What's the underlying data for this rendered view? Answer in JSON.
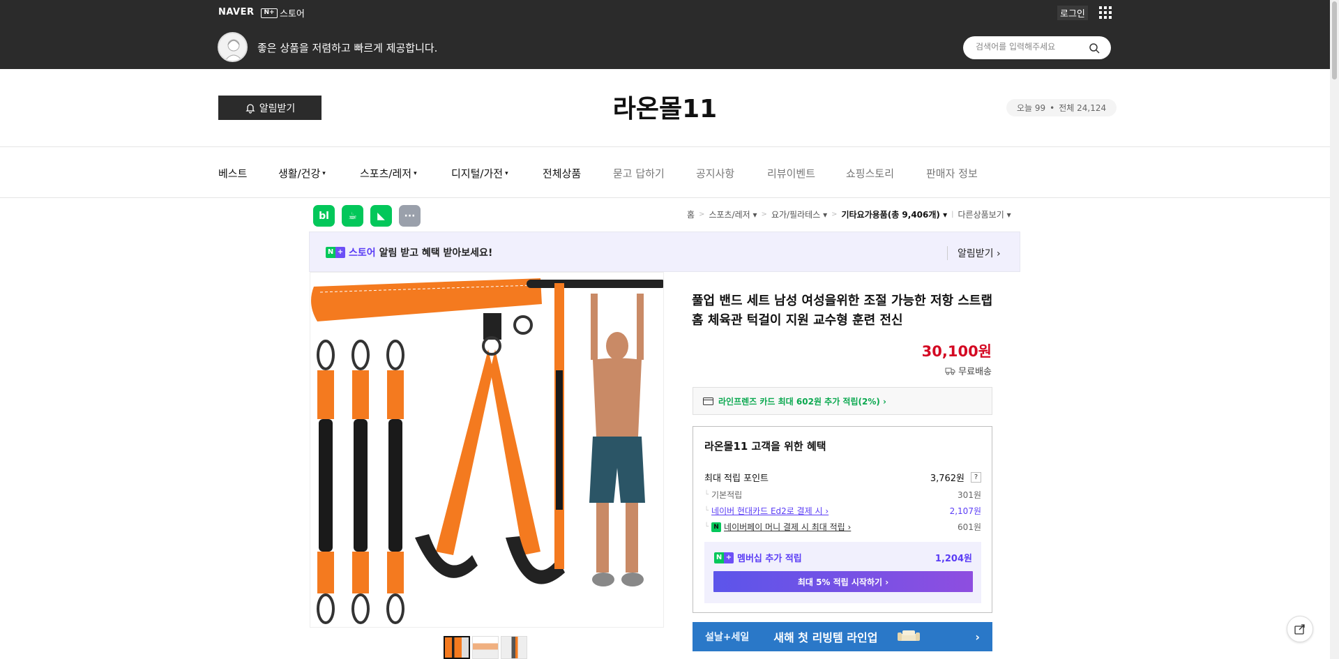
{
  "topbar": {
    "naver_logo": "NAVER",
    "nstore_box": "N+",
    "nstore_label": "스토어",
    "login": "로그인",
    "slogan": "좋은 상품을 저렴하고 빠르게 제공합니다.",
    "search_placeholder": "검색어를 입력해주세요"
  },
  "store": {
    "notify_button": "알림받기",
    "title": "라온몰11",
    "visits_today": "오늘 99",
    "visits_dot": "•",
    "visits_total": "전체 24,124"
  },
  "nav": {
    "items": [
      "베스트",
      "생활/건강",
      "스포츠/레저",
      "디지털/가전",
      "전체상품",
      "묻고 답하기",
      "공지사항",
      "리뷰이벤트",
      "쇼핑스토리",
      "판매자 정보"
    ]
  },
  "share": {
    "blog": "bl",
    "cafe": "☕",
    "band": "◣",
    "more": "···"
  },
  "breadcrumb": {
    "home": "홈",
    "sep": ">",
    "c1": "스포츠/레저",
    "c2": "요가/필라테스",
    "c3": "기타요가용품(총 9,406개)",
    "other": "다른상품보기"
  },
  "promo": {
    "store_label": "스토어",
    "text": "알림 받고 혜택 받아보세요!",
    "action": "알림받기 ›"
  },
  "product": {
    "title": "풀업 밴드 세트 남성 여성을위한 조절 가능한 저항 스트랩 홈 체육관 턱걸이 지원 교수형 훈련 전신",
    "price": "30,100원",
    "shipping": "무료배송",
    "card_offer": "라인프렌즈 카드 최대 602원 추가 적립(2%) ›"
  },
  "benefit": {
    "title": "라온몰11 고객을 위한 혜택",
    "max_points_label": "최대 적립 포인트",
    "max_points_value": "3,762원",
    "help": "?",
    "rows": [
      {
        "label": "기본적립",
        "value": "301원"
      },
      {
        "label": "네이버 현대카드 Ed2로 결제 시 ›",
        "value": "2,107원"
      },
      {
        "label": "네이버페이 머니 결제 시 최대 적립 ›",
        "value": "601원"
      }
    ],
    "membership_label": "멤버십 추가 적립",
    "membership_value": "1,204원",
    "membership_cta": "최대 5% 적립 시작하기 ›"
  },
  "ad": {
    "left": "설날+세일",
    "main": "새해 첫 리빙템 라인업",
    "arrow": "›"
  },
  "colors": {
    "header_bg": "#2b2b2b",
    "price_red": "#d40923",
    "naver_green": "#03c75a",
    "nplus_purple": "#5a3cf5"
  }
}
